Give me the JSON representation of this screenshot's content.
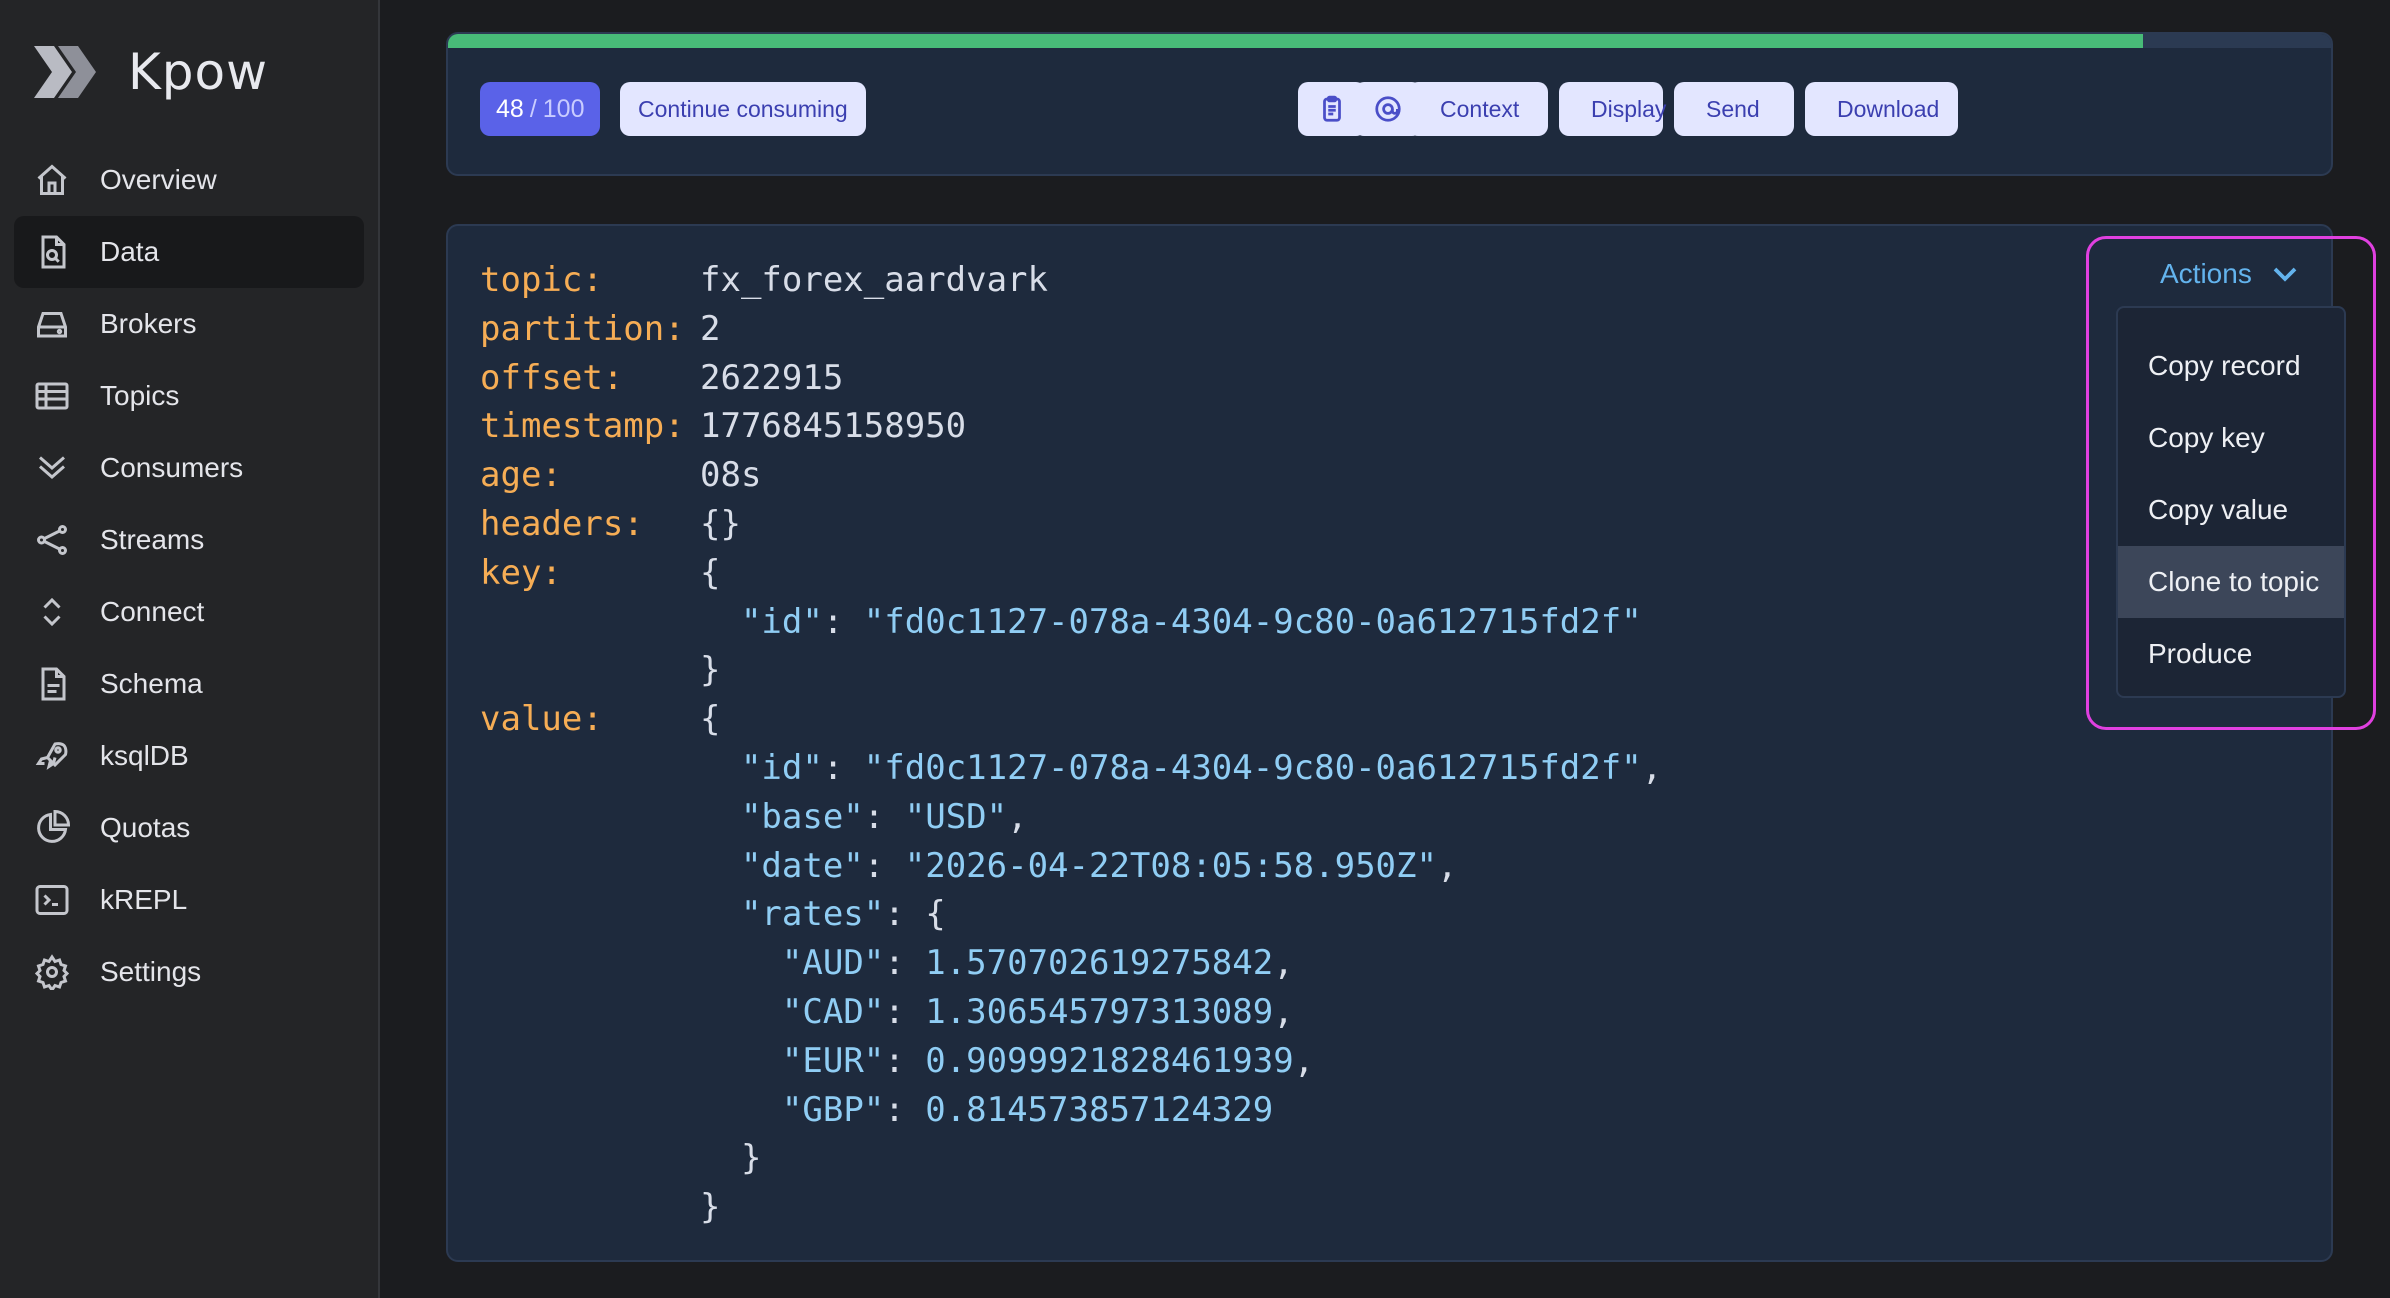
{
  "app": {
    "name": "Kpow"
  },
  "sidebar": {
    "items": [
      {
        "label": "Overview",
        "icon": "home-icon"
      },
      {
        "label": "Data",
        "icon": "data-icon",
        "active": true
      },
      {
        "label": "Brokers",
        "icon": "brokers-icon"
      },
      {
        "label": "Topics",
        "icon": "topics-icon"
      },
      {
        "label": "Consumers",
        "icon": "consumers-icon"
      },
      {
        "label": "Streams",
        "icon": "streams-icon"
      },
      {
        "label": "Connect",
        "icon": "connect-icon"
      },
      {
        "label": "Schema",
        "icon": "schema-icon"
      },
      {
        "label": "ksqlDB",
        "icon": "rocket-icon"
      },
      {
        "label": "Quotas",
        "icon": "pie-icon"
      },
      {
        "label": "kREPL",
        "icon": "terminal-icon"
      },
      {
        "label": "Settings",
        "icon": "gear-icon"
      }
    ]
  },
  "toolbar": {
    "progress_fraction": 0.9,
    "count_current": "48",
    "count_total": "100",
    "count_separator": "/",
    "continue_label": "Continue consuming",
    "context_label": "Context",
    "display_label": "Display",
    "send_label": "Send",
    "download_label": "Download",
    "icons": [
      "clipboard-icon",
      "at-sign-icon",
      "list-icon",
      "sliders-icon",
      "send-icon",
      "download-file-icon",
      "chevron-down-icon"
    ]
  },
  "record": {
    "fields": [
      {
        "key": "topic:",
        "value": "fx_forex_aardvark"
      },
      {
        "key": "partition:",
        "value": "2"
      },
      {
        "key": "offset:",
        "value": "2622915"
      },
      {
        "key": "timestamp:",
        "value": "1776845158950"
      },
      {
        "key": "age:",
        "value": "08s"
      },
      {
        "key": "headers:",
        "value": "{}"
      }
    ],
    "key_label": "key:",
    "key_id": "fd0c1127-078a-4304-9c80-0a612715fd2f",
    "value_label": "value:",
    "value": {
      "id": "fd0c1127-078a-4304-9c80-0a612715fd2f",
      "base": "USD",
      "date": "2026-04-22T08:05:58.950Z",
      "rates": [
        {
          "code": "AUD",
          "rate": "1.570702619275842"
        },
        {
          "code": "CAD",
          "rate": "1.306545797313089"
        },
        {
          "code": "EUR",
          "rate": "0.9099921828461939"
        },
        {
          "code": "GBP",
          "rate": "0.814573857124329"
        }
      ]
    }
  },
  "actions": {
    "label": "Actions",
    "menu": [
      "Copy record",
      "Copy key",
      "Copy value",
      "Clone to topic",
      "Produce"
    ],
    "hovered": "Clone to topic",
    "highlight_color": "#e040e0"
  },
  "colors": {
    "accent": "#5a62e8",
    "progress": "#48bb78",
    "key_orange": "#f6ad55",
    "string_blue": "#90cdf4",
    "link_blue": "#63b3ed"
  }
}
